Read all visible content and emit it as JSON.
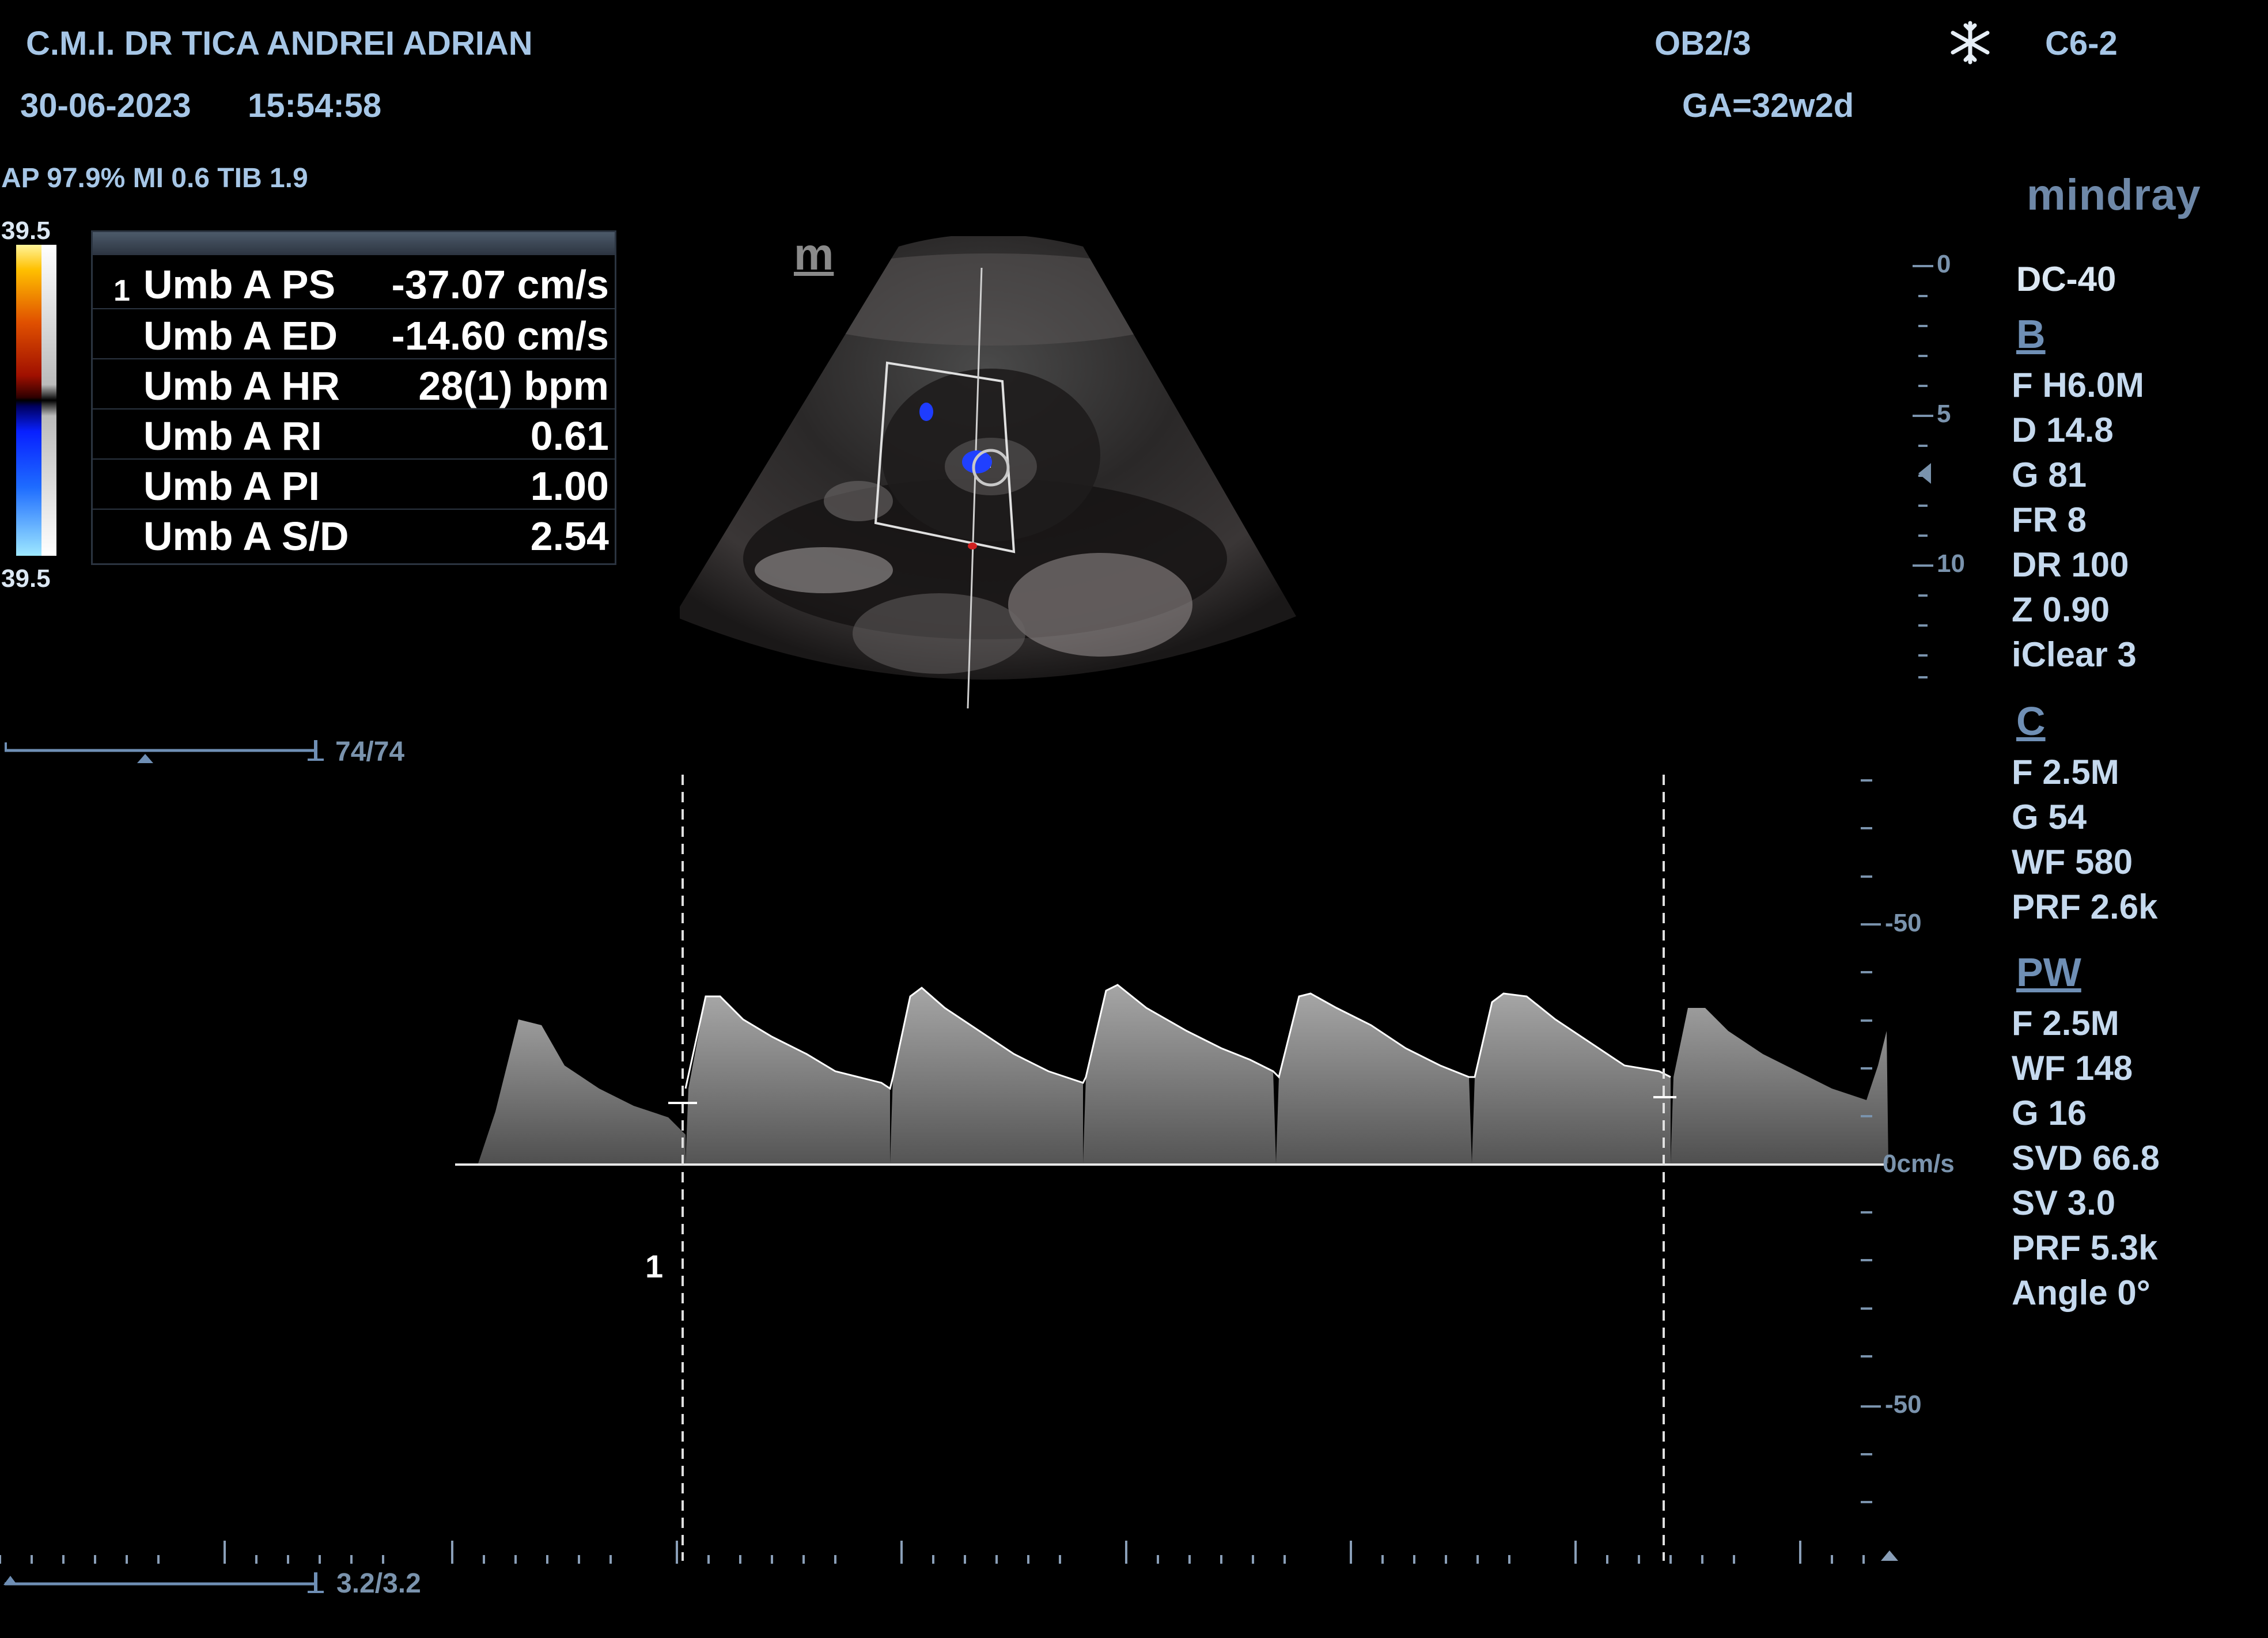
{
  "header": {
    "clinic": "C.M.I. DR TICA ANDREI ADRIAN",
    "date": "30-06-2023",
    "time": "15:54:58",
    "preset": "OB2/3",
    "probe": "C6-2",
    "ga": "GA=32w2d",
    "freeze_icon": "snowflake-icon",
    "acoustic": "AP 97.9%  MI 0.6 TIB 1.9"
  },
  "brand": {
    "logo": "mindray",
    "model": "DC-40",
    "small_mark": "m"
  },
  "color_bar": {
    "top": "39.5",
    "bottom": "39.5"
  },
  "measurements": {
    "index": "1",
    "rows": [
      {
        "label": "Umb A PS",
        "value": "-37.07 cm/s"
      },
      {
        "label": "Umb A ED",
        "value": "-14.60 cm/s"
      },
      {
        "label": "Umb A HR",
        "value": "28(1) bpm"
      },
      {
        "label": "Umb A RI",
        "value": "0.61"
      },
      {
        "label": "Umb A PI",
        "value": "1.00"
      },
      {
        "label": "Umb A S/D",
        "value": "2.54"
      }
    ]
  },
  "depth_scale": {
    "labels": [
      "0",
      "5",
      "10"
    ]
  },
  "b_mode": {
    "title": "B",
    "params": [
      "F H6.0M",
      "D 14.8",
      "G 81",
      "FR 8",
      "DR 100",
      "Z 0.90",
      "iClear 3"
    ]
  },
  "c_mode": {
    "title": "C",
    "params": [
      "F 2.5M",
      "G 54",
      "WF 580",
      "PRF 2.6k"
    ]
  },
  "pw_mode": {
    "title": "PW",
    "params": [
      "F 2.5M",
      "WF 148",
      "G 16",
      "SVD 66.8",
      "SV 3.0",
      "PRF 5.3k",
      "Angle 0°"
    ]
  },
  "cine": {
    "upper": "74/74",
    "lower": "3.2/3.2"
  },
  "spectrum": {
    "velocity_labels": [
      "-50",
      "0cm/s",
      "-50"
    ],
    "cursor_index": "1"
  },
  "colors": {
    "text_blue": "#a6c6e6",
    "scale_blue": "#7a93ad",
    "background": "#000000"
  }
}
